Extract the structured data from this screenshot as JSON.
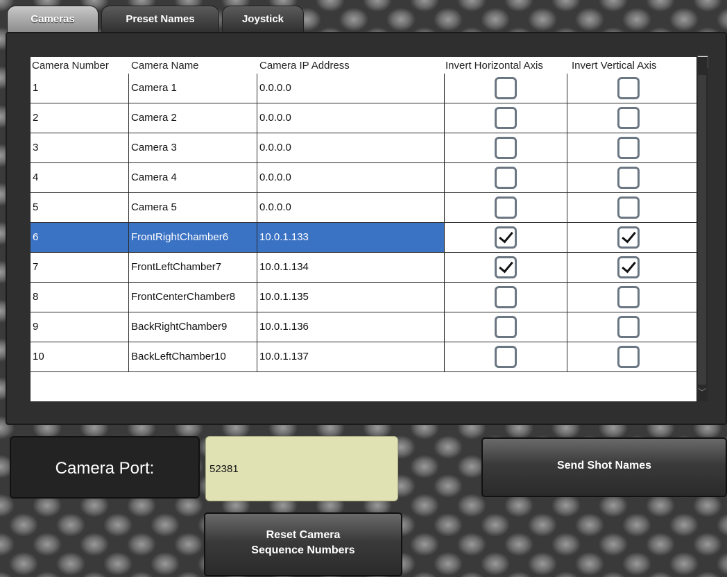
{
  "tabs": [
    {
      "label": "Cameras",
      "active": true
    },
    {
      "label": "Preset Names",
      "active": false
    },
    {
      "label": "Joystick",
      "active": false
    }
  ],
  "table": {
    "columns": [
      "Camera Number",
      "Camera Name",
      "Camera IP Address",
      "Invert Horizontal Axis",
      "Invert Vertical Axis"
    ],
    "rows": [
      {
        "number": "1",
        "name": "Camera 1",
        "ip": "0.0.0.0",
        "invert_h": false,
        "invert_v": false,
        "selected": false
      },
      {
        "number": "2",
        "name": "Camera 2",
        "ip": "0.0.0.0",
        "invert_h": false,
        "invert_v": false,
        "selected": false
      },
      {
        "number": "3",
        "name": "Camera 3",
        "ip": "0.0.0.0",
        "invert_h": false,
        "invert_v": false,
        "selected": false
      },
      {
        "number": "4",
        "name": "Camera 4",
        "ip": "0.0.0.0",
        "invert_h": false,
        "invert_v": false,
        "selected": false
      },
      {
        "number": "5",
        "name": "Camera 5",
        "ip": "0.0.0.0",
        "invert_h": false,
        "invert_v": false,
        "selected": false
      },
      {
        "number": "6",
        "name": "FrontRightChamber6",
        "ip": "10.0.1.133",
        "invert_h": true,
        "invert_v": true,
        "selected": true
      },
      {
        "number": "7",
        "name": "FrontLeftChamber7",
        "ip": "10.0.1.134",
        "invert_h": true,
        "invert_v": true,
        "selected": false
      },
      {
        "number": "8",
        "name": "FrontCenterChamber8",
        "ip": "10.0.1.135",
        "invert_h": false,
        "invert_v": false,
        "selected": false
      },
      {
        "number": "9",
        "name": "BackRightChamber9",
        "ip": "10.0.1.136",
        "invert_h": false,
        "invert_v": false,
        "selected": false
      },
      {
        "number": "10",
        "name": "BackLeftChamber10",
        "ip": "10.0.1.137",
        "invert_h": false,
        "invert_v": false,
        "selected": false
      }
    ]
  },
  "camera_port": {
    "label": "Camera Port:",
    "value": "52381"
  },
  "buttons": {
    "send_shot_names": "Send Shot Names",
    "reset_line1": "Reset Camera",
    "reset_line2": "Sequence Numbers"
  },
  "colors": {
    "selection": "#3a72c4",
    "port_field": "#e0e2b4",
    "active_tab": "#a8a8a8"
  },
  "icons": {
    "checkbox_checked": "check-icon",
    "column_chooser": "column-chooser-icon"
  }
}
